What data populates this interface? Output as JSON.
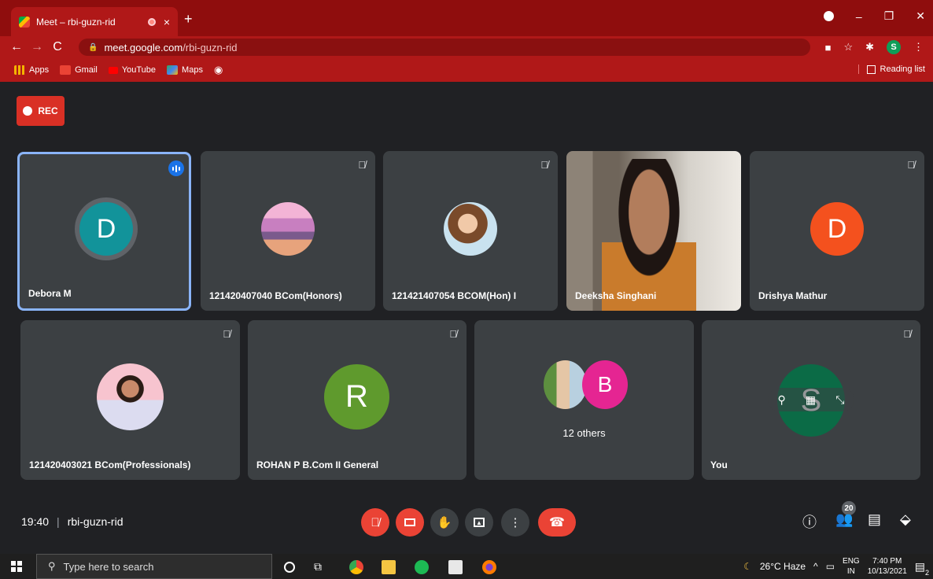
{
  "browser": {
    "tab_title": "Meet – rbi-guzn-rid",
    "tab_close": "×",
    "new_tab": "+",
    "url_domain": "meet.google.com",
    "url_path": "/rbi-guzn-rid",
    "profile_initial": "S",
    "win_minimize": "–",
    "win_restore": "❐",
    "win_close": "✕"
  },
  "bookmarks": {
    "items": [
      {
        "label": "Apps",
        "color": "#f4b400"
      },
      {
        "label": "Gmail",
        "color": "#ea4335"
      },
      {
        "label": "YouTube",
        "color": "#ff0000"
      },
      {
        "label": "Maps",
        "color": "#34a853"
      }
    ],
    "reading_list": "Reading list"
  },
  "meet": {
    "rec_label": "REC",
    "tiles": [
      {
        "name": "Debora M",
        "initial": "D",
        "color": "#12939a"
      },
      {
        "name": "121420407040 BCom(Honors)"
      },
      {
        "name": "121421407054 BCOM(Hon) I"
      },
      {
        "name": "Deeksha Singhani"
      },
      {
        "name": "Drishya Mathur",
        "initial": "D",
        "color": "#f4511e"
      },
      {
        "name": "121420403021 BCom(Professionals)"
      },
      {
        "name": "ROHAN P B.Com II General",
        "initial": "R",
        "color": "#5f9a2d"
      },
      {
        "name": "12 others",
        "initial": "B",
        "color": "#e52592"
      },
      {
        "name": "You",
        "initial": "S",
        "color": "#0b6b46"
      }
    ],
    "clock": "19:40",
    "meeting_code": "rbi-guzn-rid",
    "people_count": "20"
  },
  "taskbar": {
    "search_placeholder": "Type here to search",
    "weather": "26°C  Haze",
    "lang_top": "ENG",
    "lang_bottom": "IN",
    "time": "7:40 PM",
    "date": "10/13/2021",
    "notif_count": "2"
  }
}
